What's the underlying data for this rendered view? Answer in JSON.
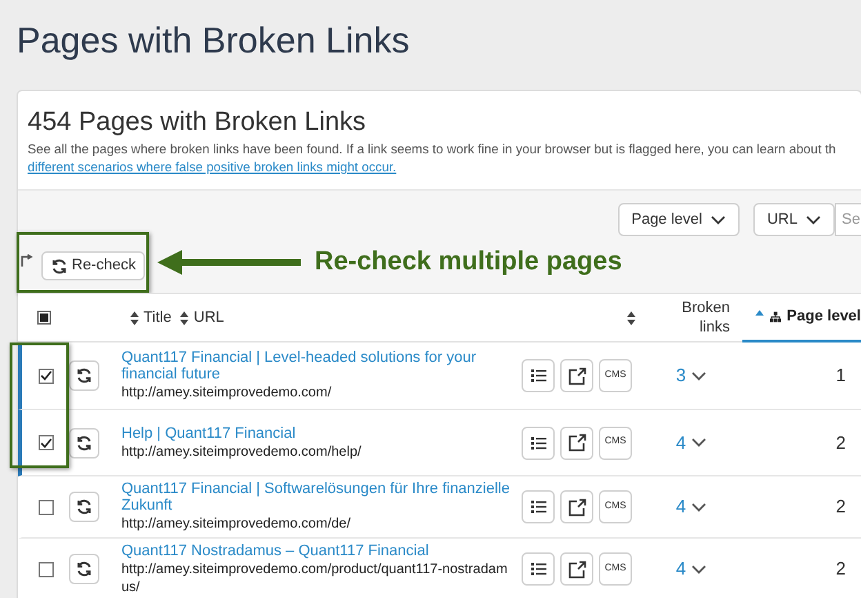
{
  "page_title": "Pages with Broken Links",
  "card": {
    "heading": "454 Pages with Broken Links",
    "description": "See all the pages where broken links have been found. If a link seems to work fine in your browser but is flagged here, you can learn about th",
    "link": "different scenarios where false positive broken links might occur."
  },
  "filters": [
    {
      "label": "Page level"
    },
    {
      "label": "URL"
    }
  ],
  "search": {
    "placeholder": "Se"
  },
  "recheck_button": "Re-check",
  "callout": {
    "text": "Re-check multiple pages"
  },
  "table": {
    "select_all": {
      "indeterminate": true
    },
    "columns": [
      {
        "label": "Title",
        "sorted": false
      },
      {
        "label": "URL",
        "sorted": false
      },
      {
        "label": "Broken links",
        "sorted": false
      },
      {
        "label": "Page level",
        "sorted": true
      }
    ],
    "rows": [
      {
        "title": "Quant117 Financial | Level-headed solutions for your financial future",
        "url": "http://amey.siteimprovedemo.com/",
        "cms": "CMS",
        "broken_links": "3",
        "page_level": "1",
        "checked": true
      },
      {
        "title": "Help | Quant117 Financial",
        "url": "http://amey.siteimprovedemo.com/help/",
        "cms": "CMS",
        "broken_links": "4",
        "page_level": "2",
        "checked": true
      },
      {
        "title": "Quant117 Financial | Softwarelösungen für Ihre finanzielle Zukunft",
        "url": "http://amey.siteimprovedemo.com/de/",
        "cms": "CMS",
        "broken_links": "4",
        "page_level": "2",
        "checked": false
      },
      {
        "title": "Quant117 Nostradamus – Quant117 Financial",
        "url": "http://amey.siteimprovedemo.com/product/quant117-nostradamus/",
        "cms": "CMS",
        "broken_links": "4",
        "page_level": "2",
        "checked": false
      }
    ]
  }
}
